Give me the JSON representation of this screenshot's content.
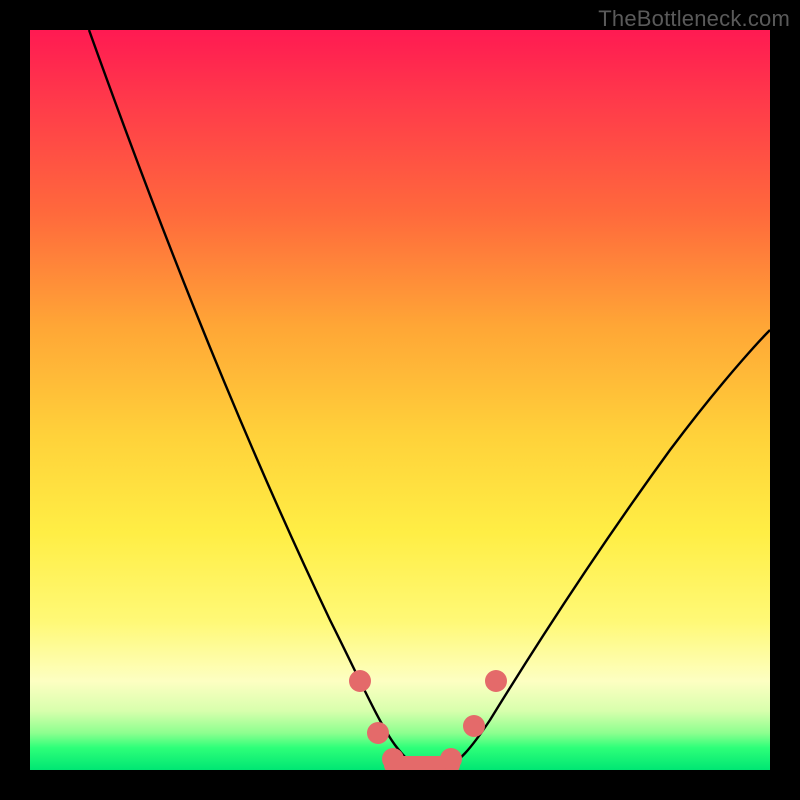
{
  "watermark": "TheBottleneck.com",
  "chart_data": {
    "type": "line",
    "title": "",
    "xlabel": "",
    "ylabel": "",
    "xlim": [
      0,
      100
    ],
    "ylim": [
      0,
      100
    ],
    "series": [
      {
        "name": "bottleneck-curve",
        "x": [
          8,
          12,
          18,
          24,
          30,
          36,
          40,
          44,
          47,
          49,
          51,
          54,
          57,
          60,
          64,
          70,
          78,
          88,
          100
        ],
        "y": [
          100,
          90,
          76,
          62,
          48,
          34,
          24,
          14,
          7,
          2,
          0,
          0,
          2,
          7,
          14,
          24,
          36,
          48,
          60
        ]
      }
    ],
    "markers": [
      {
        "name": "marker-left-upper",
        "x": 44.5,
        "y": 12
      },
      {
        "name": "marker-left-lower",
        "x": 47,
        "y": 5
      },
      {
        "name": "marker-bottom-1",
        "x": 49,
        "y": 1.5
      },
      {
        "name": "marker-bottom-2",
        "x": 51,
        "y": 0
      },
      {
        "name": "marker-bottom-3",
        "x": 54,
        "y": 0
      },
      {
        "name": "marker-bottom-4",
        "x": 57,
        "y": 1.5
      },
      {
        "name": "marker-right-lower",
        "x": 60,
        "y": 6
      },
      {
        "name": "marker-right-upper",
        "x": 63,
        "y": 12
      }
    ],
    "marker_style": {
      "color": "#e46a6a",
      "radius_px": 11
    },
    "flat_segment": {
      "x1": 49,
      "x2": 57,
      "y": 0
    }
  }
}
